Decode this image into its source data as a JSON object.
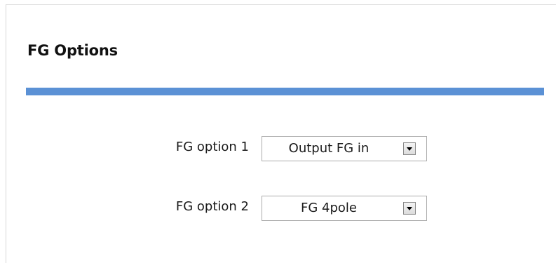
{
  "section": {
    "title": "FG Options",
    "accent_color": "#5b91d5"
  },
  "options": [
    {
      "label": "FG option 1",
      "value": "Output FG in",
      "arrow_icon": "chevron-down-icon"
    },
    {
      "label": "FG option 2",
      "value": "FG 4pole",
      "arrow_icon": "chevron-down-icon"
    }
  ]
}
